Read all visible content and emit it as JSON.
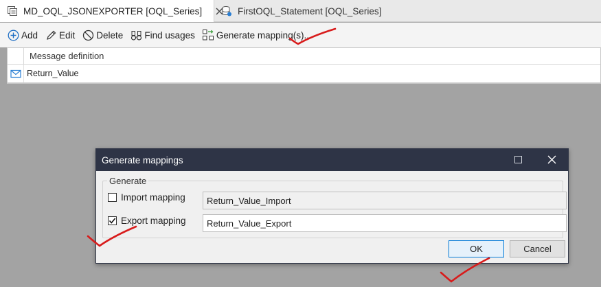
{
  "tabs": [
    {
      "label": "MD_OQL_JSONEXPORTER [OQL_Series]",
      "active": true,
      "modified": true
    },
    {
      "label": "FirstOQL_Statement [OQL_Series]",
      "active": false
    }
  ],
  "toolbar": {
    "add": "Add",
    "edit": "Edit",
    "delete": "Delete",
    "find_usages": "Find usages",
    "generate_mappings": "Generate mapping(s)..."
  },
  "grid": {
    "column": "Message definition",
    "rows": [
      {
        "name": "Return_Value"
      }
    ]
  },
  "dialog": {
    "title": "Generate mappings",
    "group_label": "Generate",
    "import": {
      "label": "Import mapping",
      "checked": false,
      "value": "Return_Value_Import",
      "enabled": false
    },
    "export": {
      "label": "Export mapping",
      "checked": true,
      "value": "Return_Value_Export",
      "enabled": true
    },
    "ok": "OK",
    "cancel": "Cancel"
  },
  "colors": {
    "dialog_title_bg": "#2e3446",
    "accent_blue": "#0078d7",
    "modified_dot": "#1d8ce0",
    "annotation_red": "#d81b1b",
    "backdrop": "#a3a3a3"
  }
}
